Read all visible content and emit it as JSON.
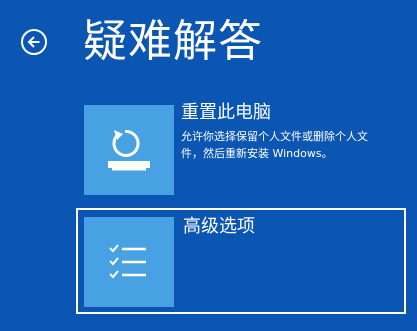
{
  "header": {
    "back_icon": "arrow-left-circle-icon",
    "title": "疑难解答"
  },
  "options": [
    {
      "icon": "reset-pc-icon",
      "title": "重置此电脑",
      "description_lines": [
        "允许你选择保留个人文件或删除个人文",
        "件，然后重新安装 Windows。"
      ]
    },
    {
      "icon": "checklist-icon",
      "title": "高级选项",
      "selected": true
    }
  ],
  "colors": {
    "background": "#0b56b3",
    "tile": "#47a1e3",
    "text": "#ffffff"
  }
}
